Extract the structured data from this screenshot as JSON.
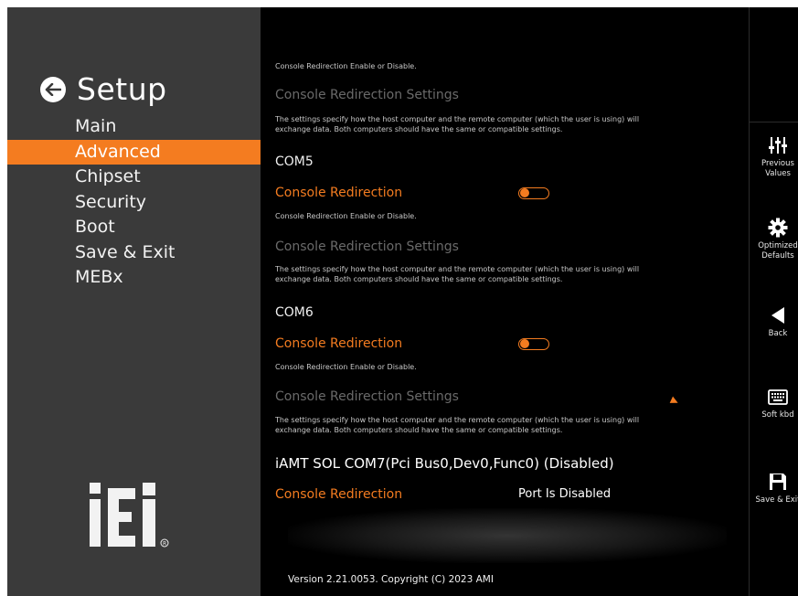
{
  "nav": {
    "title": "Setup",
    "items": [
      {
        "label": "Main",
        "active": false
      },
      {
        "label": "Advanced",
        "active": true
      },
      {
        "label": "Chipset",
        "active": false
      },
      {
        "label": "Security",
        "active": false
      },
      {
        "label": "Boot",
        "active": false
      },
      {
        "label": "Save & Exit",
        "active": false
      },
      {
        "label": "MEBx",
        "active": false
      }
    ],
    "logo": "iEi"
  },
  "content": {
    "top_help": "Console Redirection Enable or Disable.",
    "settings_title": "Console Redirection Settings",
    "settings_help_1": "The settings specify how the host computer and the remote computer (which the user is using) will",
    "settings_help_2": "exchange data. Both computers should have the same or compatible settings.",
    "com5": "COM5",
    "com6": "COM6",
    "redirection_label": "Console Redirection",
    "redirection_help": "Console Redirection Enable or Disable.",
    "iamt": "iAMT SOL COM7(Pci Bus0,Dev0,Func0) (Disabled)",
    "port_disabled": "Port Is Disabled",
    "version": "Version 2.21.0053. Copyright (C) 2023 AMI"
  },
  "toolbar": {
    "previous_values": [
      "Previous",
      "Values"
    ],
    "optimized_defaults": [
      "Optimized",
      "Defaults"
    ],
    "back": "Back",
    "soft_kbd": "Soft kbd",
    "save_exit": "Save & Exit"
  },
  "colors": {
    "accent": "#f47c20",
    "sidebar": "#3a3a3a",
    "background": "#000000"
  }
}
